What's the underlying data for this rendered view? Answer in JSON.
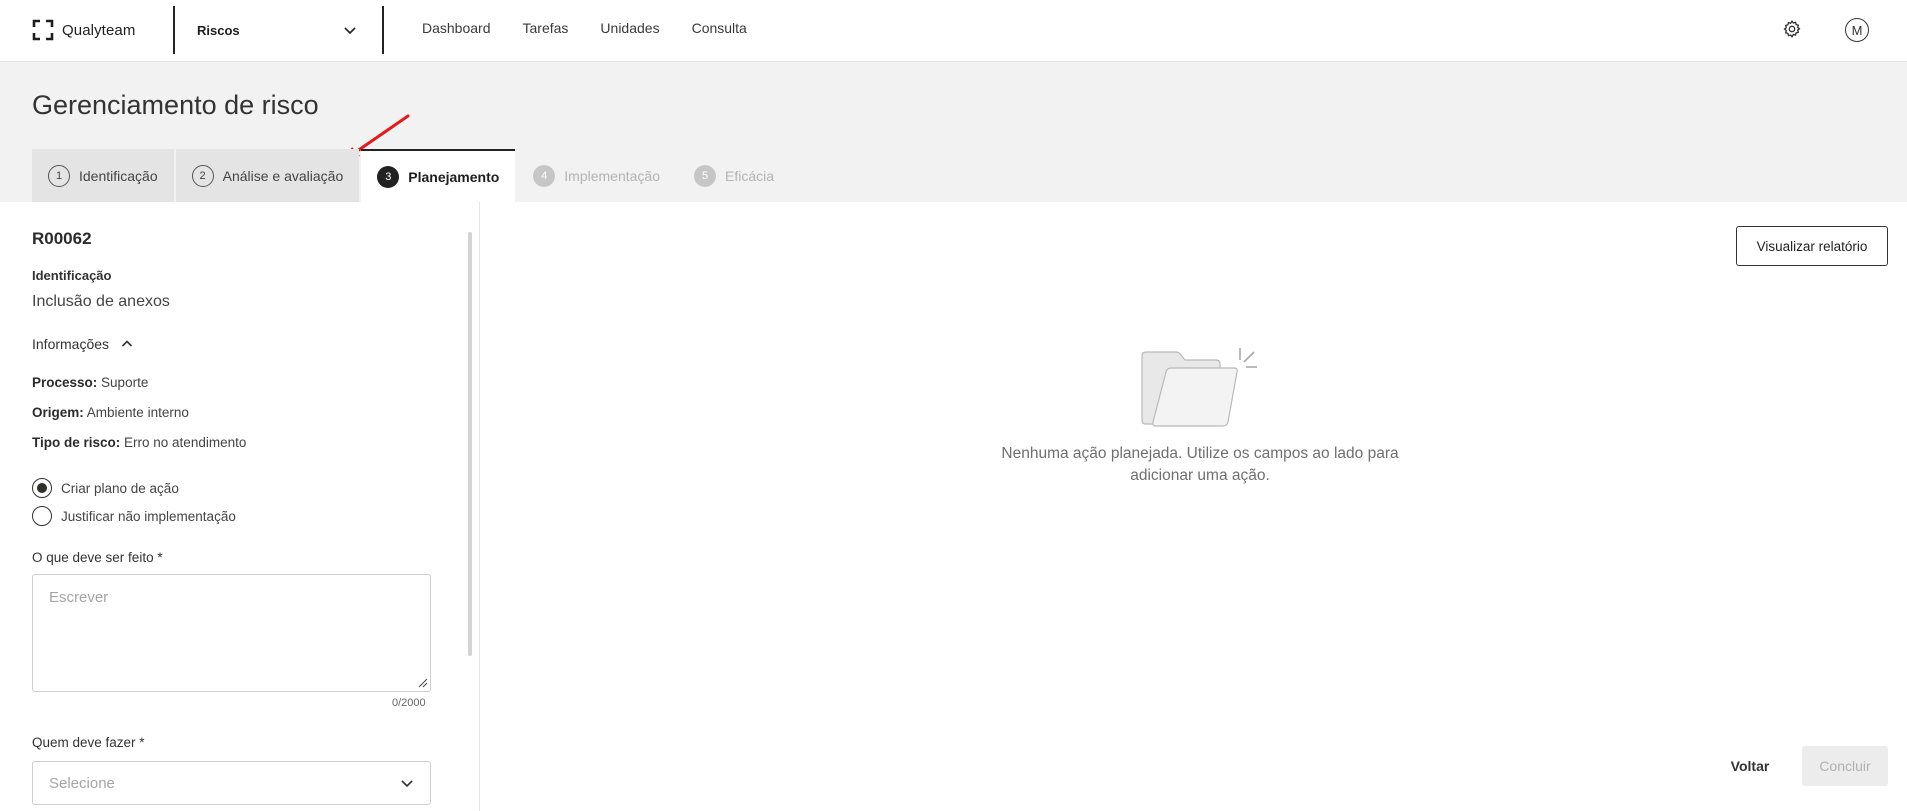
{
  "app": {
    "brand": "Qualyteam",
    "module_selector": "Riscos",
    "nav_items": [
      "Dashboard",
      "Tarefas",
      "Unidades",
      "Consulta"
    ],
    "avatar_initial": "M",
    "icons": [
      "brand-logo-icon",
      "chevron-down-icon",
      "gear-icon"
    ]
  },
  "page": {
    "title": "Gerenciamento de risco",
    "steps": [
      {
        "number": "1",
        "label": "Identificação",
        "state": "done"
      },
      {
        "number": "2",
        "label": "Análise e avaliação",
        "state": "done"
      },
      {
        "number": "3",
        "label": "Planejamento",
        "state": "active"
      },
      {
        "number": "4",
        "label": "Implementação",
        "state": "disabled"
      },
      {
        "number": "5",
        "label": "Eficácia",
        "state": "disabled"
      }
    ],
    "annotation_color": "#e3191b"
  },
  "risk": {
    "code": "R00062",
    "identification_label": "Identificação",
    "identification_value": "Inclusão de anexos",
    "info_toggle_label": "Informações",
    "info": [
      {
        "label": "Processo:",
        "value": "Suporte"
      },
      {
        "label": "Origem:",
        "value": "Ambiente interno"
      },
      {
        "label": "Tipo de risco:",
        "value": "Erro no atendimento"
      }
    ]
  },
  "form": {
    "options": [
      {
        "label": "Criar plano de ação",
        "selected": true
      },
      {
        "label": "Justificar não implementação",
        "selected": false
      }
    ],
    "what_label": "O que deve ser feito *",
    "what_placeholder": "Escrever",
    "what_counter": "0/2000",
    "who_label": "Quem deve fazer *",
    "who_placeholder": "Selecione"
  },
  "right": {
    "report_button": "Visualizar relatório",
    "empty_message": "Nenhuma ação planejada. Utilize os campos ao lado para adicionar uma ação.",
    "back_button": "Voltar",
    "finish_button": "Concluir"
  }
}
